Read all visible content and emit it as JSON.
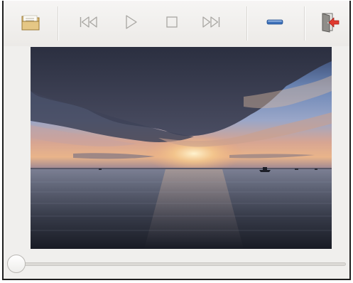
{
  "toolbar": {
    "buttons": [
      {
        "name": "open-file",
        "icon": "folder-icon"
      },
      {
        "name": "previous",
        "icon": "skip-back-icon"
      },
      {
        "name": "play",
        "icon": "play-icon"
      },
      {
        "name": "stop",
        "icon": "stop-icon"
      },
      {
        "name": "next",
        "icon": "skip-forward-icon"
      },
      {
        "name": "minimize",
        "icon": "minus-icon"
      },
      {
        "name": "quit",
        "icon": "exit-icon"
      }
    ]
  },
  "video": {
    "content": "sunset-over-sea-frame"
  },
  "seek": {
    "position": 0
  },
  "colors": {
    "minus_accent": "#3b6fb8",
    "exit_arrow": "#e03a2f",
    "folder": "#d9b66b",
    "disabled_icon": "#a8a6a2"
  }
}
